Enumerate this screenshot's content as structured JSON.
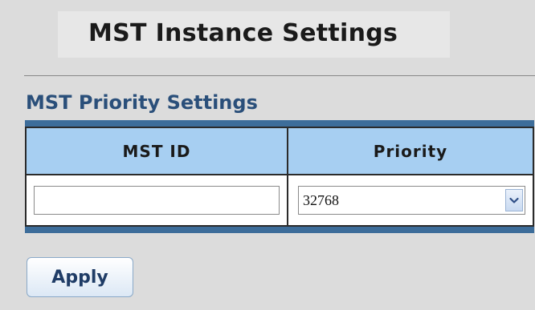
{
  "page": {
    "title": "MST Instance Settings"
  },
  "section": {
    "title": "MST Priority Settings"
  },
  "table": {
    "headers": [
      "MST ID",
      "Priority"
    ],
    "row": {
      "mst_id_value": "",
      "priority_value": "32768"
    }
  },
  "buttons": {
    "apply_label": "Apply"
  },
  "icons": {
    "dropdown": "chevron-down-icon"
  },
  "colors": {
    "section_title": "#2a4f7a",
    "table_frame": "#3d6d9a",
    "header_fill": "#a7cff2",
    "button_text": "#1f3c66"
  }
}
